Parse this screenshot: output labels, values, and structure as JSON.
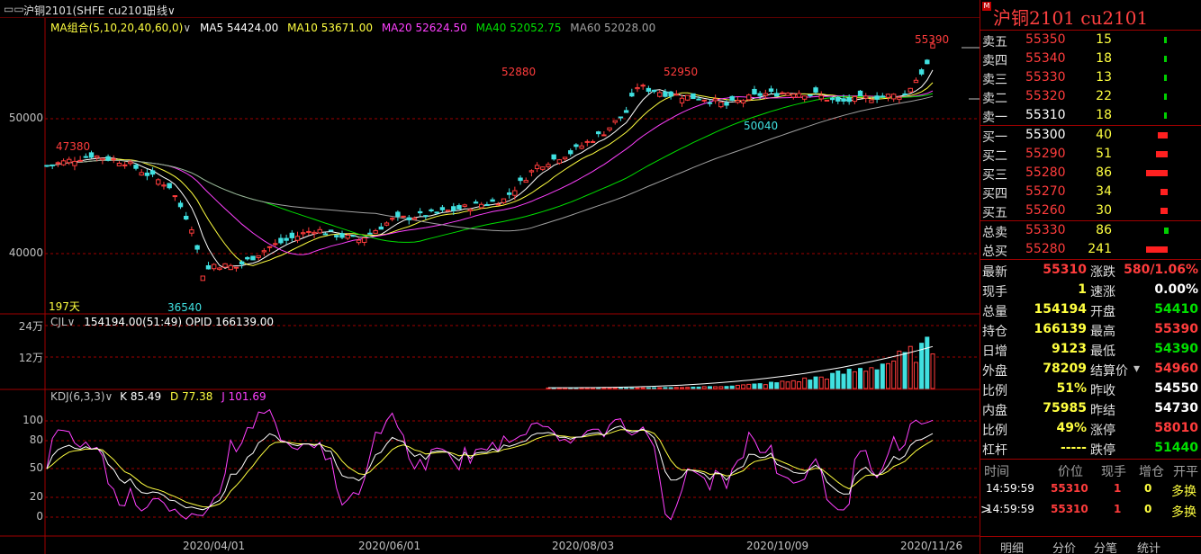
{
  "titlebar": {
    "menu_icon": "menu-icon",
    "instrument": "沪铜2101(SHFE cu2101)",
    "period": "日线"
  },
  "main_legend": {
    "combo": "MA组合(5,10,20,40,60,0)",
    "ma5": "MA5 54424.00",
    "ma10": "MA10 53671.00",
    "ma20": "MA20 52624.50",
    "ma40": "MA40 52052.75",
    "ma60": "MA60 52028.00",
    "colors": {
      "ma5": "#ffffff",
      "ma10": "#ffff40",
      "ma20": "#ff40ff",
      "ma40": "#00e000",
      "ma60": "#a0a0a0"
    }
  },
  "main_axis": {
    "labels": [
      "50000",
      "40000"
    ]
  },
  "annotations": {
    "high": "55390",
    "p1": "52880",
    "p2": "52950",
    "p3": "50040",
    "p4": "47380",
    "low": "36540",
    "days": "197天"
  },
  "volume_legend": {
    "name": "CJL",
    "text": "154194.00(51:49)  OPID 166139.00",
    "axis": [
      "24万",
      "12万"
    ]
  },
  "kdj_legend": {
    "name": "KDJ(6,3,3)",
    "k": "K 85.49",
    "d": "D 77.38",
    "j": "J 101.69",
    "axis": [
      "100",
      "80",
      "50",
      "20",
      "0"
    ]
  },
  "dates": [
    "2020/04/01",
    "2020/06/01",
    "2020/08/03",
    "2020/10/09",
    "2020/11/26"
  ],
  "panel": {
    "title": "沪铜2101  cu2101",
    "asks": [
      {
        "label": "卖五",
        "price": "55350",
        "vol": "15",
        "bar": 0.08
      },
      {
        "label": "卖四",
        "price": "55340",
        "vol": "18",
        "bar": 0.1
      },
      {
        "label": "卖三",
        "price": "55330",
        "vol": "13",
        "bar": 0.06
      },
      {
        "label": "卖二",
        "price": "55320",
        "vol": "22",
        "bar": 0.12
      },
      {
        "label": "卖一",
        "price": "55310",
        "vol": "18",
        "bar": 0.1
      }
    ],
    "bids": [
      {
        "label": "买一",
        "price": "55300",
        "vol": "40",
        "bar": 0.45
      },
      {
        "label": "买二",
        "price": "55290",
        "vol": "51",
        "bar": 0.55
      },
      {
        "label": "买三",
        "price": "55280",
        "vol": "86",
        "bar": 1.0
      },
      {
        "label": "买四",
        "price": "55270",
        "vol": "34",
        "bar": 0.35
      },
      {
        "label": "买五",
        "price": "55260",
        "vol": "30",
        "bar": 0.32
      }
    ],
    "totals": [
      {
        "label": "总卖",
        "price": "55330",
        "vol": "86",
        "bar": 0.2,
        "color": "green"
      },
      {
        "label": "总买",
        "price": "55280",
        "vol": "241",
        "bar": 1.0,
        "color": "red"
      }
    ],
    "stats": [
      {
        "l1": "最新",
        "v1": "55310",
        "c1": "red",
        "l2": "涨跌",
        "v2": "580/1.06%",
        "c2": "red"
      },
      {
        "l1": "现手",
        "v1": "1",
        "c1": "yellow",
        "l2": "速涨",
        "v2": "0.00%",
        "c2": "white"
      },
      {
        "l1": "总量",
        "v1": "154194",
        "c1": "yellow",
        "l2": "开盘",
        "v2": "54410",
        "c2": "green"
      },
      {
        "l1": "持仓",
        "v1": "166139",
        "c1": "yellow",
        "l2": "最高",
        "v2": "55390",
        "c2": "red"
      },
      {
        "l1": "日增",
        "v1": "9123",
        "c1": "yellow",
        "l2": "最低",
        "v2": "54390",
        "c2": "green"
      },
      {
        "l1": "外盘",
        "v1": "78209",
        "c1": "yellow",
        "l2": "结算价",
        "v2": "54960",
        "c2": "red"
      },
      {
        "l1": "比例",
        "v1": "51%",
        "c1": "yellow",
        "l2": "昨收",
        "v2": "54550",
        "c2": "white"
      },
      {
        "l1": "内盘",
        "v1": "75985",
        "c1": "yellow",
        "l2": "昨结",
        "v2": "54730",
        "c2": "white"
      },
      {
        "l1": "比例",
        "v1": "49%",
        "c1": "yellow",
        "l2": "涨停",
        "v2": "58010",
        "c2": "red"
      },
      {
        "l1": "杠杆",
        "v1": "-----",
        "c1": "yellow",
        "l2": "跌停",
        "v2": "51440",
        "c2": "green"
      }
    ],
    "ticks_header": [
      "时间",
      "价位",
      "现手",
      "增仓",
      "开平"
    ],
    "ticks": [
      {
        "time": "14:59:59",
        "price": "55310",
        "qty": "1",
        "oi": "0",
        "type": "多换",
        "marker": ""
      },
      {
        "time": "14:59:59",
        "price": "55310",
        "qty": "1",
        "oi": "0",
        "type": "多换",
        "marker": ">"
      }
    ],
    "tabs": [
      "明细",
      "分价",
      "分笔",
      "统计"
    ]
  }
}
